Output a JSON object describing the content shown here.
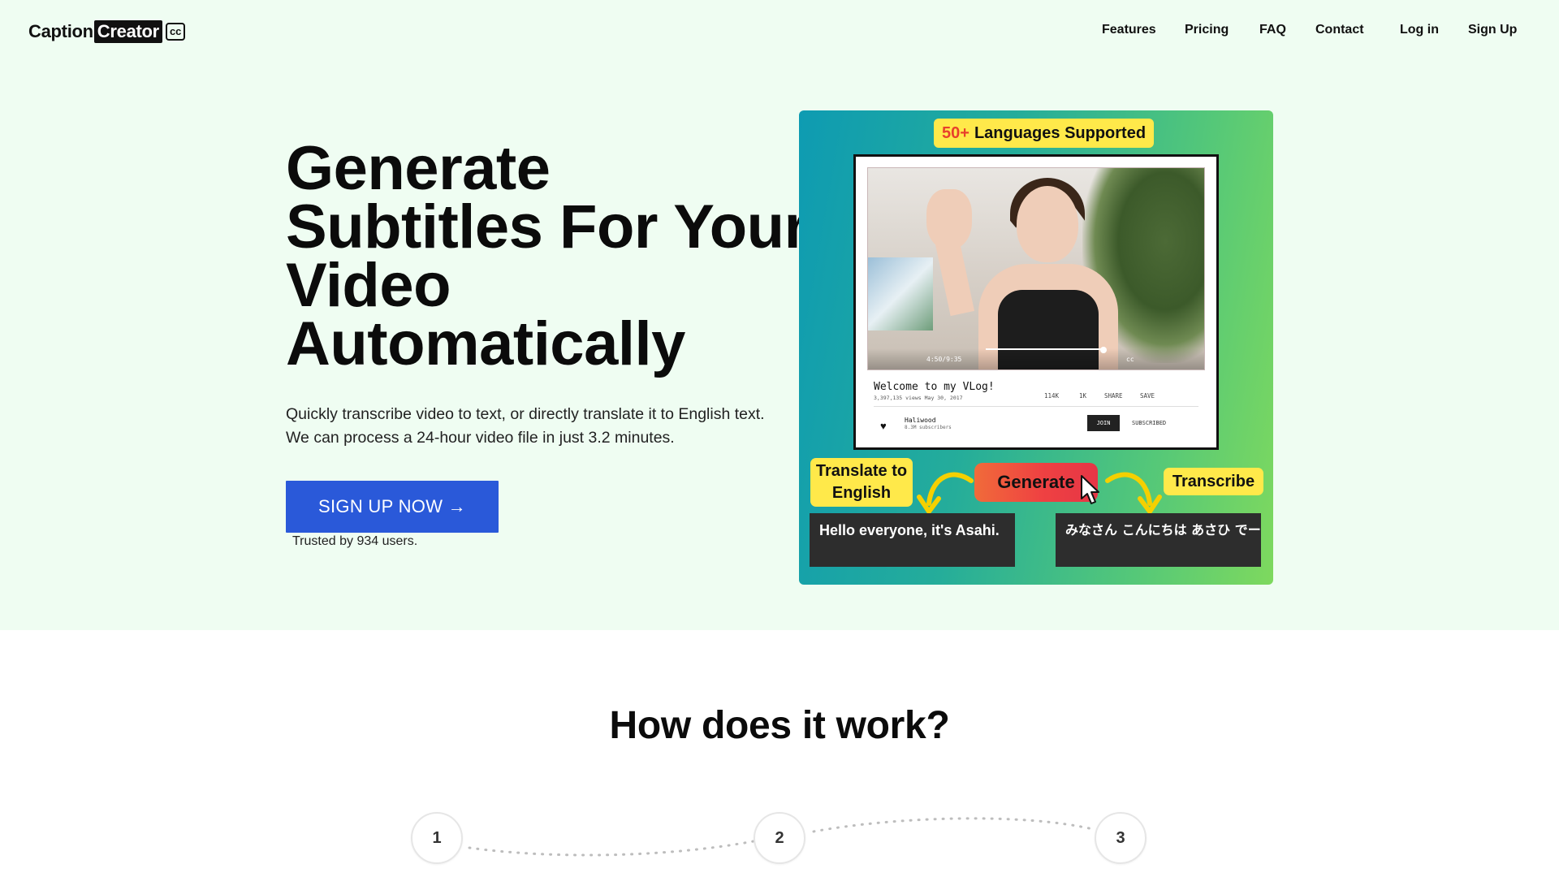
{
  "logo": {
    "part1": "Caption",
    "part2": "Creator",
    "badge": "cc"
  },
  "nav": {
    "features": "Features",
    "pricing": "Pricing",
    "faq": "FAQ",
    "contact": "Contact",
    "login": "Log in",
    "signup": "Sign Up"
  },
  "hero": {
    "title_line1": "Generate",
    "title_highlight": "Subtitles",
    "title_line2_rest": " For Your",
    "title_line3": "Video",
    "title_line4": "Automatically",
    "description": "Quickly transcribe video to text, or directly translate it to English text. We can process a 24-hour video file in just 3.2 minutes.",
    "cta_label": "SIGN UP NOW →",
    "trusted": "Trusted by 934 users."
  },
  "promo": {
    "badge_number": "50+",
    "badge_text": "Languages Supported",
    "video": {
      "time": "4:50/9:35",
      "cc": "cc",
      "title": "Welcome to my VLog!",
      "meta": "3,397,135 views  May 30, 2017",
      "likes": "114K",
      "comments": "1K",
      "share": "SHARE",
      "save": "SAVE",
      "channel": "Haliwood",
      "subscribers": "8.3M subscribers",
      "join": "JOIN",
      "subscribed": "SUBSCRIBED"
    },
    "translate_tag_line1": "Translate to",
    "translate_tag_line2": "English",
    "generate_label": "Generate",
    "transcribe_tag": "Transcribe",
    "caption_en": "Hello everyone, it's Asahi.",
    "caption_jp": "みなさん こんにちは あさひ でーす"
  },
  "how": {
    "title": "How does it work?",
    "steps": [
      "1",
      "2",
      "3"
    ]
  },
  "colors": {
    "hero_bg": "#effdf2",
    "cta_blue": "#2a59d9",
    "highlight_green": "#3ee07b",
    "tag_yellow": "#ffe94a"
  }
}
